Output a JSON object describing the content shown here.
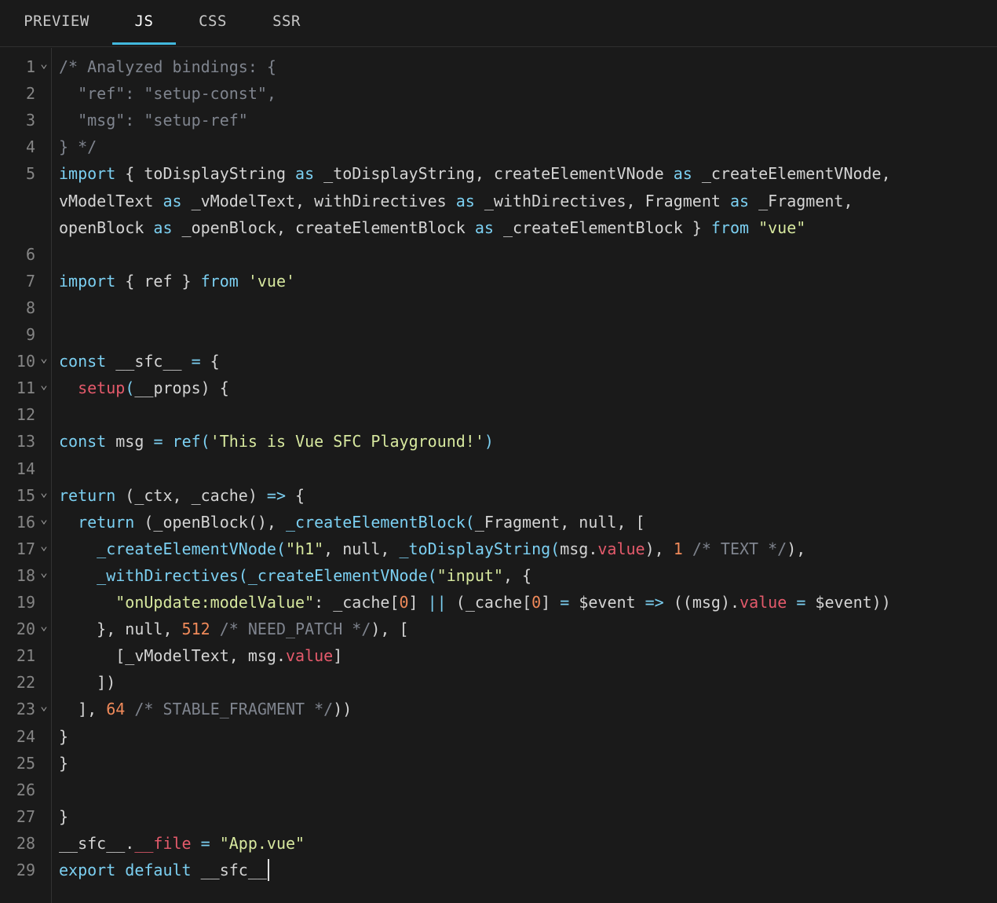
{
  "tabs": [
    {
      "label": "PREVIEW",
      "active": false
    },
    {
      "label": "JS",
      "active": true
    },
    {
      "label": "CSS",
      "active": false
    },
    {
      "label": "SSR",
      "active": false
    }
  ],
  "accent_color": "#42b8dd",
  "editor": {
    "fold_icon": "chevron-down-icon",
    "lines": [
      {
        "n": "1",
        "fold": true,
        "rows": [
          [
            [
              "c-cm",
              "/* Analyzed bindings: {"
            ]
          ]
        ]
      },
      {
        "n": "2",
        "fold": false,
        "rows": [
          [
            [
              "c-cm",
              "  \"ref\": \"setup-const\","
            ]
          ]
        ]
      },
      {
        "n": "3",
        "fold": false,
        "rows": [
          [
            [
              "c-cm",
              "  \"msg\": \"setup-ref\""
            ]
          ]
        ]
      },
      {
        "n": "4",
        "fold": false,
        "rows": [
          [
            [
              "c-cm",
              "} */"
            ]
          ]
        ]
      },
      {
        "n": "5",
        "fold": false,
        "rows": [
          [
            [
              "c-kw",
              "import"
            ],
            [
              "c-id",
              " { toDisplayString "
            ],
            [
              "c-kw",
              "as"
            ],
            [
              "c-id",
              " _toDisplayString, createElementVNode "
            ],
            [
              "c-kw",
              "as"
            ],
            [
              "c-id",
              " _createElementVNode,"
            ]
          ],
          [
            [
              "c-id",
              "vModelText "
            ],
            [
              "c-kw",
              "as"
            ],
            [
              "c-id",
              " _vModelText, withDirectives "
            ],
            [
              "c-kw",
              "as"
            ],
            [
              "c-id",
              " _withDirectives, Fragment "
            ],
            [
              "c-kw",
              "as"
            ],
            [
              "c-id",
              " _Fragment,"
            ]
          ],
          [
            [
              "c-id",
              "openBlock "
            ],
            [
              "c-kw",
              "as"
            ],
            [
              "c-id",
              " _openBlock, createElementBlock "
            ],
            [
              "c-kw",
              "as"
            ],
            [
              "c-id",
              " _createElementBlock } "
            ],
            [
              "c-kw",
              "from"
            ],
            [
              "c-id",
              " "
            ],
            [
              "c-str",
              "\"vue\""
            ]
          ]
        ]
      },
      {
        "n": "6",
        "fold": false,
        "rows": [
          [
            [
              "c-id",
              ""
            ]
          ]
        ]
      },
      {
        "n": "7",
        "fold": false,
        "rows": [
          [
            [
              "c-kw",
              "import"
            ],
            [
              "c-id",
              " { ref } "
            ],
            [
              "c-kw",
              "from"
            ],
            [
              "c-id",
              " "
            ],
            [
              "c-str",
              "'vue'"
            ]
          ]
        ]
      },
      {
        "n": "8",
        "fold": false,
        "rows": [
          [
            [
              "c-id",
              ""
            ]
          ]
        ]
      },
      {
        "n": "9",
        "fold": false,
        "rows": [
          [
            [
              "c-id",
              ""
            ]
          ]
        ]
      },
      {
        "n": "10",
        "fold": true,
        "rows": [
          [
            [
              "c-kw",
              "const"
            ],
            [
              "c-id",
              " __sfc__ "
            ],
            [
              "c-pu",
              "="
            ],
            [
              "c-id",
              " {"
            ]
          ]
        ]
      },
      {
        "n": "11",
        "fold": true,
        "rows": [
          [
            [
              "c-id",
              "  "
            ],
            [
              "c-fn",
              "setup"
            ],
            [
              "c-pu",
              "("
            ],
            [
              "c-id",
              "__props) {"
            ]
          ]
        ]
      },
      {
        "n": "12",
        "fold": false,
        "rows": [
          [
            [
              "c-id",
              ""
            ]
          ]
        ]
      },
      {
        "n": "13",
        "fold": false,
        "rows": [
          [
            [
              "c-kw",
              "const"
            ],
            [
              "c-id",
              " msg "
            ],
            [
              "c-pu",
              "="
            ],
            [
              "c-id",
              " "
            ],
            [
              "c-kw",
              "ref"
            ],
            [
              "c-pu",
              "("
            ],
            [
              "c-str",
              "'This is Vue SFC Playground!'"
            ],
            [
              "c-pu",
              ")"
            ]
          ]
        ]
      },
      {
        "n": "14",
        "fold": false,
        "rows": [
          [
            [
              "c-id",
              ""
            ]
          ]
        ]
      },
      {
        "n": "15",
        "fold": true,
        "rows": [
          [
            [
              "c-kw",
              "return"
            ],
            [
              "c-id",
              " (_ctx, _cache) "
            ],
            [
              "c-pu",
              "=>"
            ],
            [
              "c-id",
              " {"
            ]
          ]
        ]
      },
      {
        "n": "16",
        "fold": true,
        "rows": [
          [
            [
              "c-id",
              "  "
            ],
            [
              "c-kw",
              "return"
            ],
            [
              "c-id",
              " (_openBlock(), "
            ],
            [
              "c-kw",
              "_createElementBlock"
            ],
            [
              "c-pu",
              "("
            ],
            [
              "c-id",
              "_Fragment, null, ["
            ]
          ]
        ]
      },
      {
        "n": "17",
        "fold": true,
        "rows": [
          [
            [
              "c-id",
              "    "
            ],
            [
              "c-kw",
              "_createElementVNode"
            ],
            [
              "c-pu",
              "("
            ],
            [
              "c-str",
              "\"h1\""
            ],
            [
              "c-id",
              ", null, "
            ],
            [
              "c-kw",
              "_toDisplayString"
            ],
            [
              "c-pu",
              "("
            ],
            [
              "c-id",
              "msg."
            ],
            [
              "c-pr",
              "value"
            ],
            [
              "c-id",
              "), "
            ],
            [
              "c-num",
              "1"
            ],
            [
              "c-id",
              " "
            ],
            [
              "c-cm",
              "/* TEXT */"
            ],
            [
              "c-id",
              "),"
            ]
          ]
        ]
      },
      {
        "n": "18",
        "fold": true,
        "rows": [
          [
            [
              "c-id",
              "    "
            ],
            [
              "c-kw",
              "_withDirectives"
            ],
            [
              "c-pu",
              "("
            ],
            [
              "c-kw",
              "_createElementVNode"
            ],
            [
              "c-pu",
              "("
            ],
            [
              "c-str",
              "\"input\""
            ],
            [
              "c-id",
              ", {"
            ]
          ]
        ]
      },
      {
        "n": "19",
        "fold": false,
        "rows": [
          [
            [
              "c-id",
              "      "
            ],
            [
              "c-str",
              "\"onUpdate:modelValue\""
            ],
            [
              "c-id",
              ": _cache["
            ],
            [
              "c-num",
              "0"
            ],
            [
              "c-id",
              "] "
            ],
            [
              "c-pu",
              "||"
            ],
            [
              "c-id",
              " (_cache["
            ],
            [
              "c-num",
              "0"
            ],
            [
              "c-id",
              "] "
            ],
            [
              "c-pu",
              "="
            ],
            [
              "c-id",
              " $event "
            ],
            [
              "c-pu",
              "=>"
            ],
            [
              "c-id",
              " ((msg)."
            ],
            [
              "c-pr",
              "value"
            ],
            [
              "c-id",
              " "
            ],
            [
              "c-pu",
              "="
            ],
            [
              "c-id",
              " $event))"
            ]
          ]
        ]
      },
      {
        "n": "20",
        "fold": true,
        "rows": [
          [
            [
              "c-id",
              "    }, null, "
            ],
            [
              "c-num",
              "512"
            ],
            [
              "c-id",
              " "
            ],
            [
              "c-cm",
              "/* NEED_PATCH */"
            ],
            [
              "c-id",
              "), ["
            ]
          ]
        ]
      },
      {
        "n": "21",
        "fold": false,
        "rows": [
          [
            [
              "c-id",
              "      [_vModelText, msg."
            ],
            [
              "c-pr",
              "value"
            ],
            [
              "c-id",
              "]"
            ]
          ]
        ]
      },
      {
        "n": "22",
        "fold": false,
        "rows": [
          [
            [
              "c-id",
              "    ])"
            ]
          ]
        ]
      },
      {
        "n": "23",
        "fold": true,
        "rows": [
          [
            [
              "c-id",
              "  ], "
            ],
            [
              "c-num",
              "64"
            ],
            [
              "c-id",
              " "
            ],
            [
              "c-cm",
              "/* STABLE_FRAGMENT */"
            ],
            [
              "c-id",
              "))"
            ]
          ]
        ]
      },
      {
        "n": "24",
        "fold": false,
        "rows": [
          [
            [
              "c-id",
              "}"
            ]
          ]
        ]
      },
      {
        "n": "25",
        "fold": false,
        "rows": [
          [
            [
              "c-id",
              "}"
            ]
          ]
        ]
      },
      {
        "n": "26",
        "fold": false,
        "rows": [
          [
            [
              "c-id",
              ""
            ]
          ]
        ]
      },
      {
        "n": "27",
        "fold": false,
        "rows": [
          [
            [
              "c-id",
              "}"
            ]
          ]
        ]
      },
      {
        "n": "28",
        "fold": false,
        "rows": [
          [
            [
              "c-id",
              "__sfc__."
            ],
            [
              "c-pr",
              "__file"
            ],
            [
              "c-id",
              " "
            ],
            [
              "c-pu",
              "="
            ],
            [
              "c-id",
              " "
            ],
            [
              "c-str",
              "\"App.vue\""
            ]
          ]
        ]
      },
      {
        "n": "29",
        "fold": false,
        "rows": [
          [
            [
              "c-kw",
              "export"
            ],
            [
              "c-id",
              " "
            ],
            [
              "c-kw",
              "default"
            ],
            [
              "c-id",
              " __sfc__"
            ]
          ]
        ]
      }
    ]
  }
}
